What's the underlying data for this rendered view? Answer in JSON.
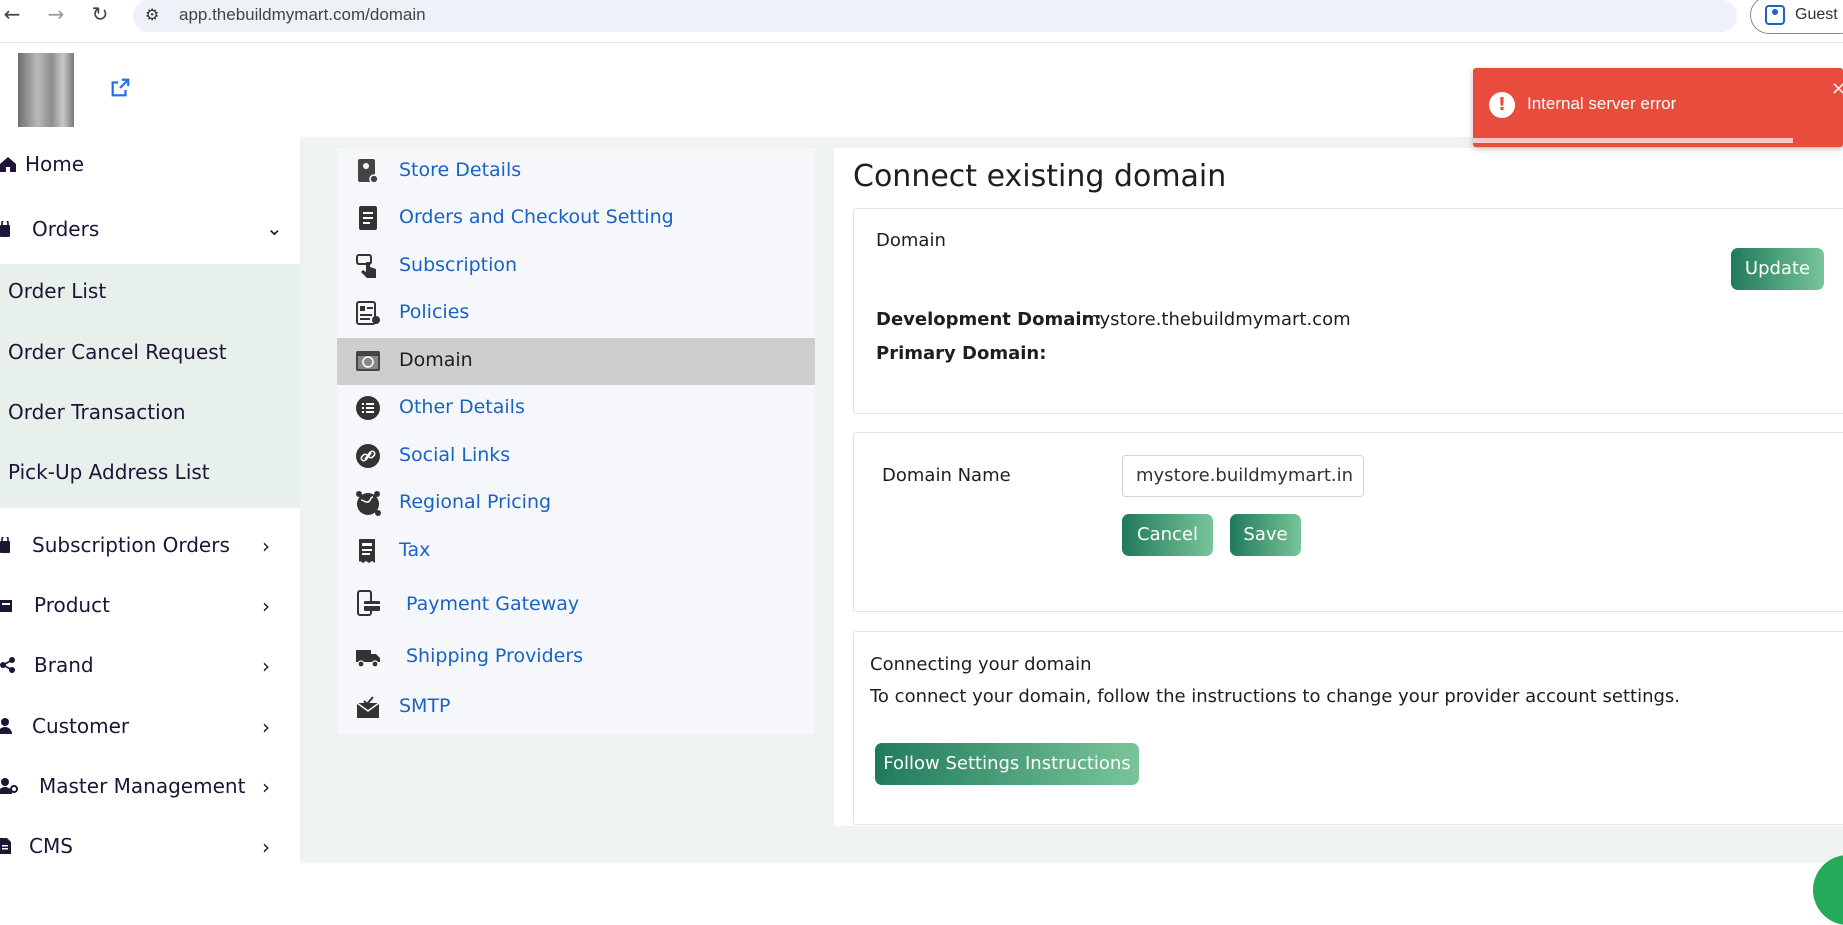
{
  "browser": {
    "url": "app.thebuildmymart.com/domain",
    "guest_label": "Guest"
  },
  "sidebar": {
    "items": [
      {
        "label": "Home"
      },
      {
        "label": "Orders"
      },
      {
        "label": "Subscription Orders"
      },
      {
        "label": "Product"
      },
      {
        "label": "Brand"
      },
      {
        "label": "Customer"
      },
      {
        "label": "Master Management"
      },
      {
        "label": "CMS"
      }
    ],
    "orders_submenu": [
      "Order List",
      "Order Cancel Request",
      "Order Transaction",
      "Pick-Up Address List"
    ]
  },
  "settings_menu": {
    "items": [
      {
        "label": "Store Details"
      },
      {
        "label": "Orders and Checkout Setting"
      },
      {
        "label": "Subscription"
      },
      {
        "label": "Policies"
      },
      {
        "label": "Domain"
      },
      {
        "label": "Other Details"
      },
      {
        "label": "Social Links"
      },
      {
        "label": "Regional Pricing"
      },
      {
        "label": "Tax"
      },
      {
        "label": "Payment Gateway"
      },
      {
        "label": "Shipping Providers"
      },
      {
        "label": "SMTP"
      }
    ],
    "active": "Domain"
  },
  "main": {
    "title": "Connect existing domain",
    "domain_card": {
      "heading": "Domain",
      "update_label": "Update",
      "dev_domain_label": "Development Domain:",
      "dev_domain_value": "mystore.thebuildmymart.com",
      "primary_domain_label": "Primary Domain:"
    },
    "domain_form": {
      "field_label": "Domain Name",
      "field_value": "mystore.buildmymart.in",
      "cancel_label": "Cancel",
      "save_label": "Save"
    },
    "connect_card": {
      "heading": "Connecting your domain",
      "description": "To connect your domain, follow the instructions to change your provider account settings.",
      "button_label": "Follow Settings Instructions"
    }
  },
  "toast": {
    "message": "Internal server error",
    "close": "×"
  },
  "colors": {
    "link_blue": "#1a62c4",
    "accent_green": "#1f7a5c",
    "error_red": "#e74c3c",
    "active_bg": "#cfcdcd"
  }
}
